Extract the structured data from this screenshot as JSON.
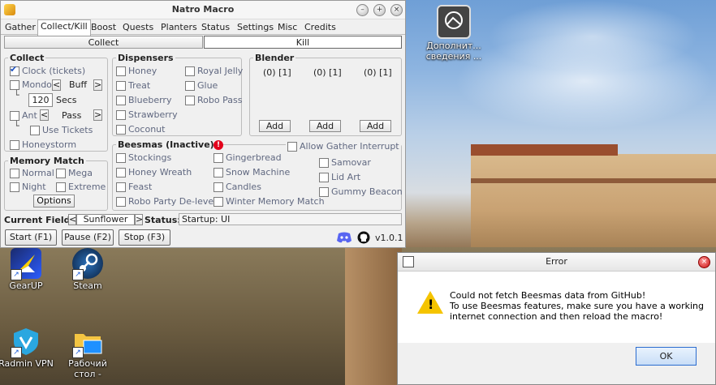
{
  "window": {
    "title": "Natro Macro",
    "tabs": [
      "Gather",
      "Collect/Kill",
      "Boost",
      "Quests",
      "Planters",
      "Status",
      "Settings",
      "Misc",
      "Credits"
    ],
    "active_tab": "Collect/Kill",
    "subtabs": [
      "Collect",
      "Kill"
    ],
    "collect": {
      "title": "Collect",
      "clock": "Clock (tickets)",
      "mondo": "Mondo",
      "mondo_mode": "Buff",
      "mondo_secs": "120",
      "secs_label": "Secs",
      "ant": "Ant",
      "ant_mode": "Pass",
      "use_tickets": "Use Tickets",
      "honeystorm": "Honeystorm"
    },
    "dispensers": {
      "title": "Dispensers",
      "left": [
        "Honey",
        "Treat",
        "Blueberry",
        "Strawberry",
        "Coconut"
      ],
      "right": [
        "Royal Jelly",
        "Glue",
        "Robo Pass"
      ]
    },
    "blender": {
      "title": "Blender",
      "slots": [
        "(0) [1]",
        "(0) [1]",
        "(0) [1]"
      ],
      "add_label": "Add"
    },
    "memory_match": {
      "title": "Memory Match",
      "items": [
        "Normal",
        "Mega",
        "Night",
        "Extreme"
      ],
      "options_label": "Options"
    },
    "beesmas": {
      "title": "Beesmas (Inactive)",
      "allow_gather": "Allow Gather Interrupt",
      "col1": [
        "Stockings",
        "Honey Wreath",
        "Feast",
        "Robo Party De-level"
      ],
      "col2": [
        "Gingerbread",
        "Snow Machine",
        "Candles",
        "Winter Memory Match"
      ],
      "col3": [
        "Samovar",
        "Lid Art",
        "Gummy Beacon"
      ]
    },
    "status_bar": {
      "current_field_label": "Current Field:",
      "current_field": "Sunflower",
      "status_label": "Status:",
      "status": "Startup: UI"
    },
    "buttons": {
      "start": "Start (F1)",
      "pause": "Pause (F2)",
      "stop": "Stop (F3)",
      "version": "v1.0.1"
    }
  },
  "desktop": {
    "icons": [
      {
        "label": "Дополнит... сведения ..."
      },
      {
        "label": "GearUP"
      },
      {
        "label": "Steam"
      },
      {
        "label": "Radmin VPN"
      },
      {
        "label": "Рабочий стол -"
      }
    ]
  },
  "error_dialog": {
    "title": "Error",
    "line1": "Could not fetch Beesmas data from GitHub!",
    "line2": "To use Beesmas features, make sure you have a working",
    "line3": "internet connection and then reload the macro!",
    "ok_label": "OK"
  }
}
